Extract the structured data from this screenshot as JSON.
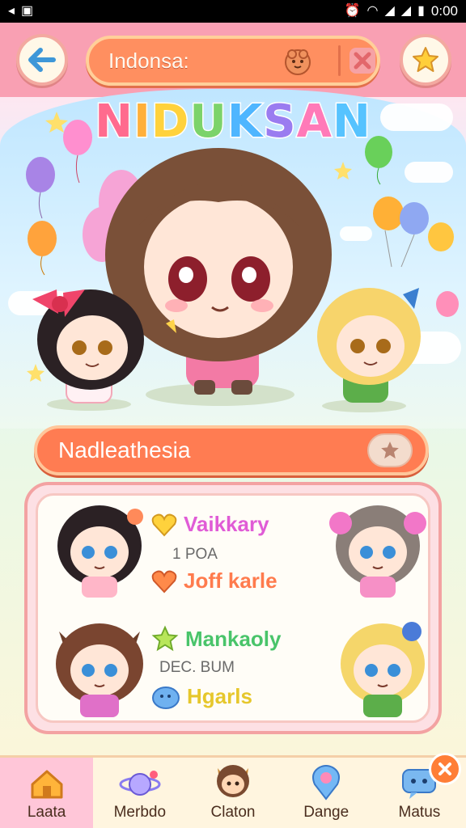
{
  "status_bar": {
    "left_icons": [
      "signal-icon",
      "image-icon"
    ],
    "right_icons": [
      "alarm-icon",
      "wifi-icon",
      "cell-icon",
      "cell-icon-2",
      "battery-icon"
    ],
    "time": "0:00"
  },
  "header": {
    "title": "Indonsa:",
    "back_icon": "arrow-left-icon",
    "favorite_icon": "star-icon"
  },
  "logo": {
    "letters": [
      "N",
      "I",
      "D",
      "U",
      "K",
      "S",
      "A",
      "N"
    ],
    "colors": [
      "#ff6b8e",
      "#ffb03a",
      "#ffd23c",
      "#7cd36a",
      "#4fb6ff",
      "#9a7cf0",
      "#ff7ab8",
      "#56c3ff"
    ]
  },
  "section": {
    "title": "Nadleathesia",
    "star_icon": "star-icon"
  },
  "list": {
    "entries": [
      {
        "label": "Vaikkary",
        "icon": "heart-gold-icon",
        "color": "#e05cd6"
      },
      {
        "label": "Joff karle",
        "icon": "heart-orange-icon",
        "color": "#ff7b4d"
      },
      {
        "label": "Mankaoly",
        "icon": "star-green-icon",
        "color": "#49c46a"
      },
      {
        "label": "Hgarls",
        "icon": "blob-blue-icon",
        "color": "#e6c72c"
      }
    ],
    "subtexts": [
      "1 POA",
      "DEC. BUM"
    ]
  },
  "nav": {
    "items": [
      {
        "label": "Laata",
        "icon": "home-icon"
      },
      {
        "label": "Merbdo",
        "icon": "planet-icon"
      },
      {
        "label": "Claton",
        "icon": "character-icon"
      },
      {
        "label": "Dange",
        "icon": "location-icon"
      },
      {
        "label": "Matus",
        "icon": "chat-icon"
      }
    ],
    "active_index": 0,
    "close_icon": "close-icon"
  },
  "colors": {
    "header_pink": "#f9a0b3",
    "pill_orange": "#ff8f60",
    "banner_orange": "#ff7c52",
    "nav_active": "#ffc6d8"
  }
}
